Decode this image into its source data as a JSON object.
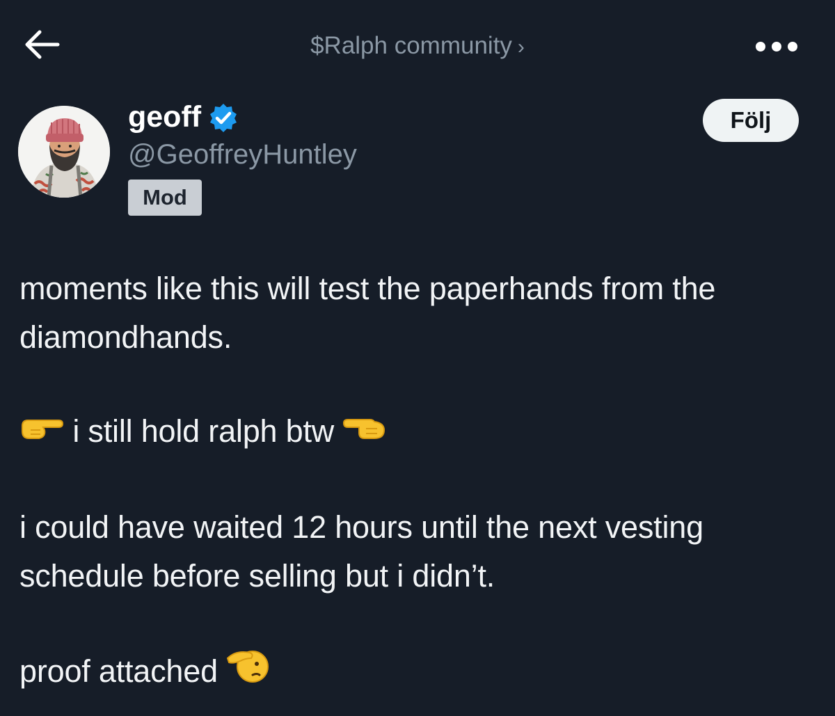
{
  "header": {
    "back_icon": "arrow-left-icon",
    "community_label": "$Ralph community",
    "community_chevron": "›",
    "more_icon": "more-horizontal-icon"
  },
  "author": {
    "display_name": "geoff",
    "verified_icon": "verified-badge-icon",
    "handle": "@GeoffreyHuntley",
    "badge": "Mod",
    "follow_label": "Följ"
  },
  "tweet": {
    "paragraph1": "moments like this will test the paperhands from the diamondhands.",
    "paragraph2": "i still hold ralph btw",
    "paragraph2_emoji_left": "backhand-index-pointing-right-emoji",
    "paragraph2_emoji_right": "backhand-index-pointing-right-emoji",
    "paragraph3": "i could have waited 12 hours until the next vesting schedule before selling but i didn’t.",
    "paragraph4": "proof attached",
    "paragraph4_emoji": "saluting-face-emoji"
  },
  "colors": {
    "background": "#161d28",
    "secondary_text": "#8b98a5",
    "verified_blue": "#1d9bf0",
    "follow_button_bg": "#eff3f4",
    "mod_badge_bg": "#c9ced4"
  }
}
